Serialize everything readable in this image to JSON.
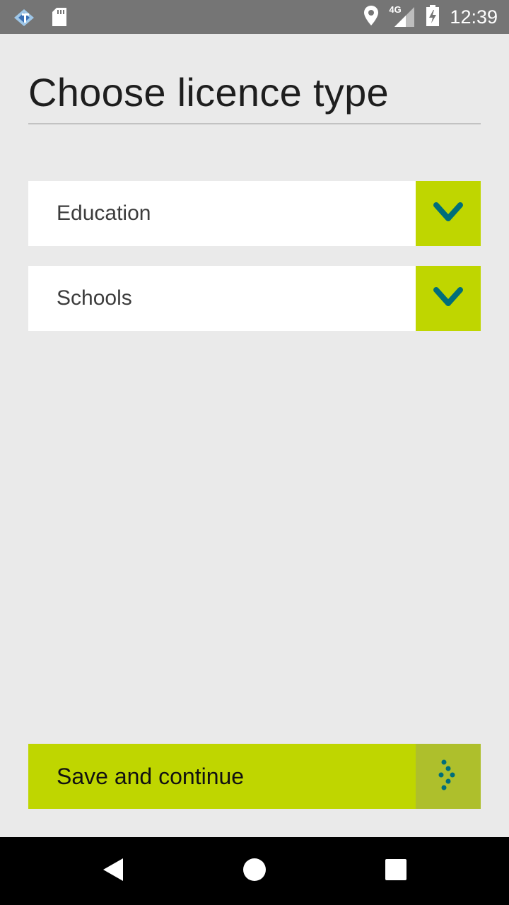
{
  "status_bar": {
    "time": "12:39",
    "network_label": "4G",
    "icons": [
      "app-notification-icon",
      "sd-card-icon",
      "location-icon",
      "cell-signal-icon",
      "battery-charging-icon"
    ]
  },
  "page": {
    "title": "Choose licence type"
  },
  "selects": [
    {
      "value": "Education",
      "toggle_icon": "chevron-down-icon"
    },
    {
      "value": "Schools",
      "toggle_icon": "chevron-down-icon"
    }
  ],
  "save_button": {
    "label": "Save and continue",
    "icon": "loading-spinner-icon"
  },
  "nav_bar": {
    "buttons": [
      "back",
      "home",
      "recents"
    ]
  },
  "colors": {
    "accent": "#bfd600",
    "accent_dark": "#aebf2c",
    "chevron": "#006e7a",
    "background": "#eaeaea",
    "status_bar": "#757575"
  }
}
